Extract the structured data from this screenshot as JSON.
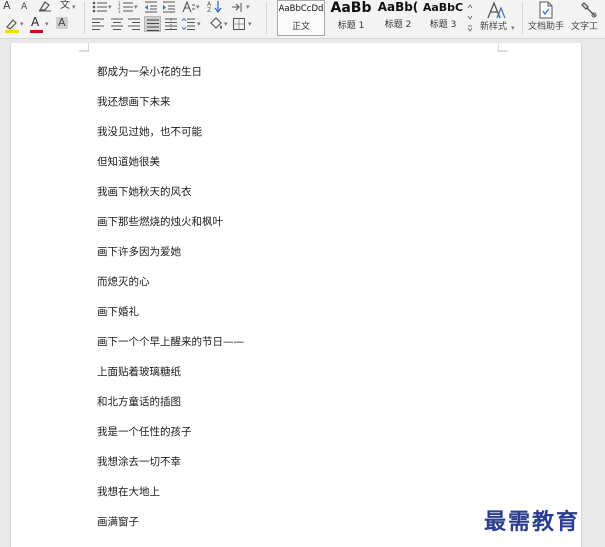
{
  "toolbar": {
    "font_grow_label": "A",
    "font_shrink_label": "A",
    "phonetic_label": "文",
    "highlight_label": "A",
    "font_color_label": "A",
    "char_shading_label": "A",
    "text_effect_label": "A"
  },
  "styles": [
    {
      "sample": "AaBbCcDd",
      "name": "正文",
      "selected": true
    },
    {
      "sample": "AaBb",
      "name": "标题 1"
    },
    {
      "sample": "AaBb(",
      "name": "标题 2"
    },
    {
      "sample": "AaBbC",
      "name": "标题 3"
    }
  ],
  "new_style": {
    "label": "新样式"
  },
  "doc_assistant": {
    "label": "文档助手"
  },
  "text_tools": {
    "label": "文字工"
  },
  "colors": {
    "font_color_bar": "#d6001c",
    "highlight_bar": "#ffd800",
    "watermark": "#2a3d8f"
  },
  "document": {
    "lines": [
      "都成为一朵小花的生日",
      "我还想画下未来",
      "我没见过她，也不可能",
      "但知道她很美",
      "我画下她秋天的风衣",
      "画下那些燃烧的烛火和枫叶",
      "画下许多因为爱她",
      "而熄灭的心",
      "画下婚礼",
      "画下一个个早上醒来的节日——",
      "上面贴着玻璃糖纸",
      "和北方童话的插图",
      "我是一个任性的孩子",
      "我想涂去一切不幸",
      "我想在大地上",
      "画满窗子"
    ]
  },
  "watermark": {
    "text": "最需教育"
  }
}
